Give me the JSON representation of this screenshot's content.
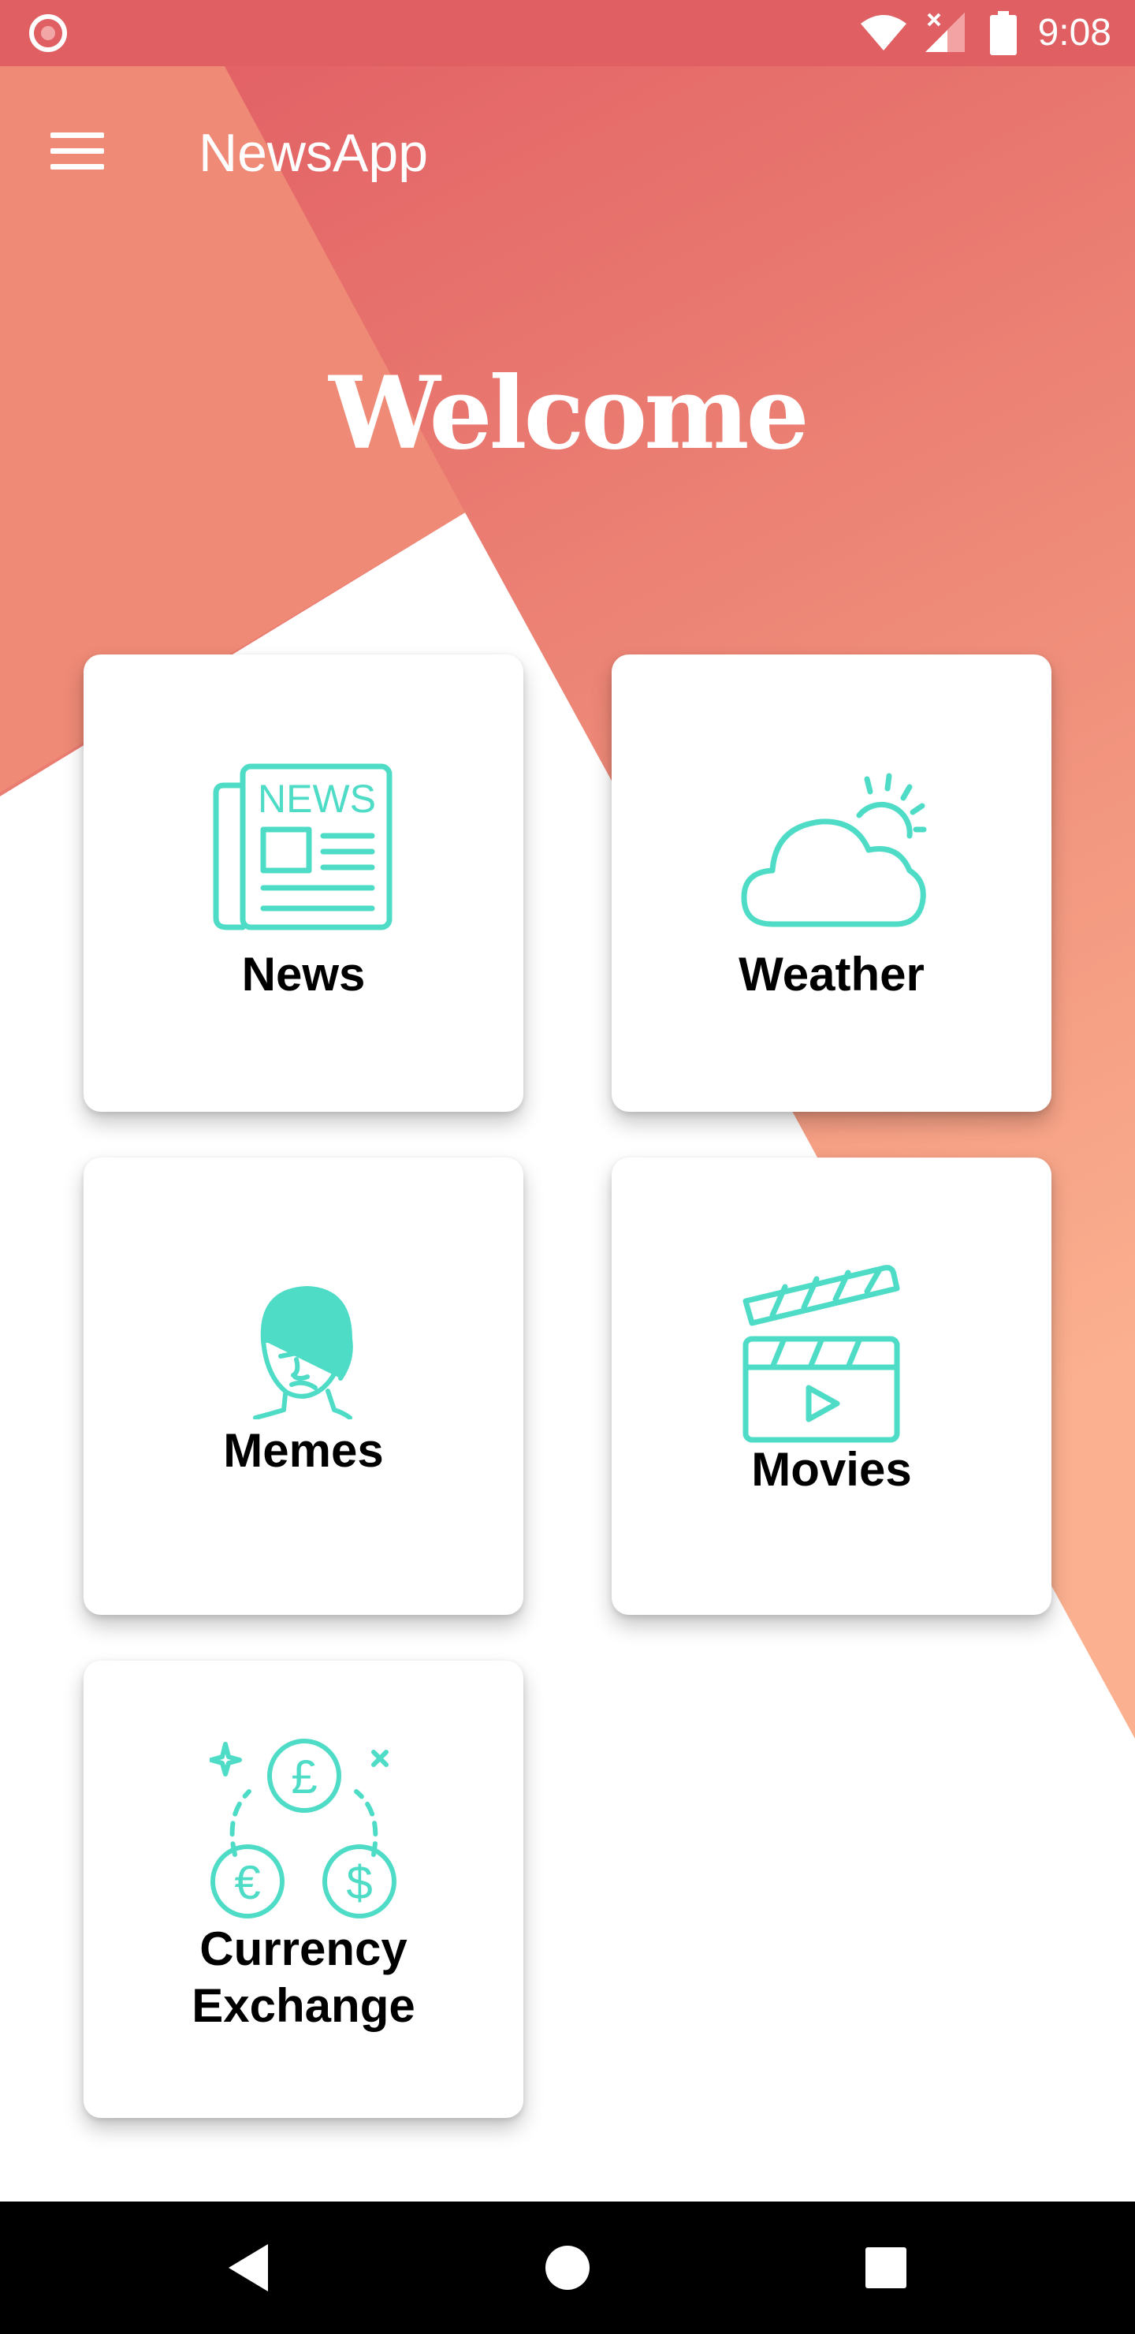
{
  "status_bar": {
    "time": "9:08",
    "icons": [
      "record-icon",
      "wifi-icon",
      "signal-icon",
      "battery-icon"
    ]
  },
  "toolbar": {
    "title": "NewsApp",
    "menu_icon": "hamburger-menu-icon"
  },
  "hero": {
    "welcome": "Welcome"
  },
  "cards": [
    {
      "label": "News",
      "icon": "newspaper-icon"
    },
    {
      "label": "Weather",
      "icon": "cloud-sun-icon"
    },
    {
      "label": "Memes",
      "icon": "meme-face-icon"
    },
    {
      "label": "Movies",
      "icon": "clapperboard-icon"
    },
    {
      "label_line1": "Currency",
      "label_line2": "Exchange",
      "icon": "currency-exchange-icon"
    }
  ],
  "nav_bar": {
    "buttons": [
      "back-triangle-icon",
      "home-circle-icon",
      "recents-square-icon"
    ]
  },
  "colors": {
    "status_bar": "#df5f63",
    "gradient_top": "#e05c61",
    "gradient_bottom": "#fbb08f",
    "left_wedge": "#ee8a76",
    "icon_accent": "#4fdcc7",
    "card_bg": "#ffffff",
    "label": "#000000"
  }
}
